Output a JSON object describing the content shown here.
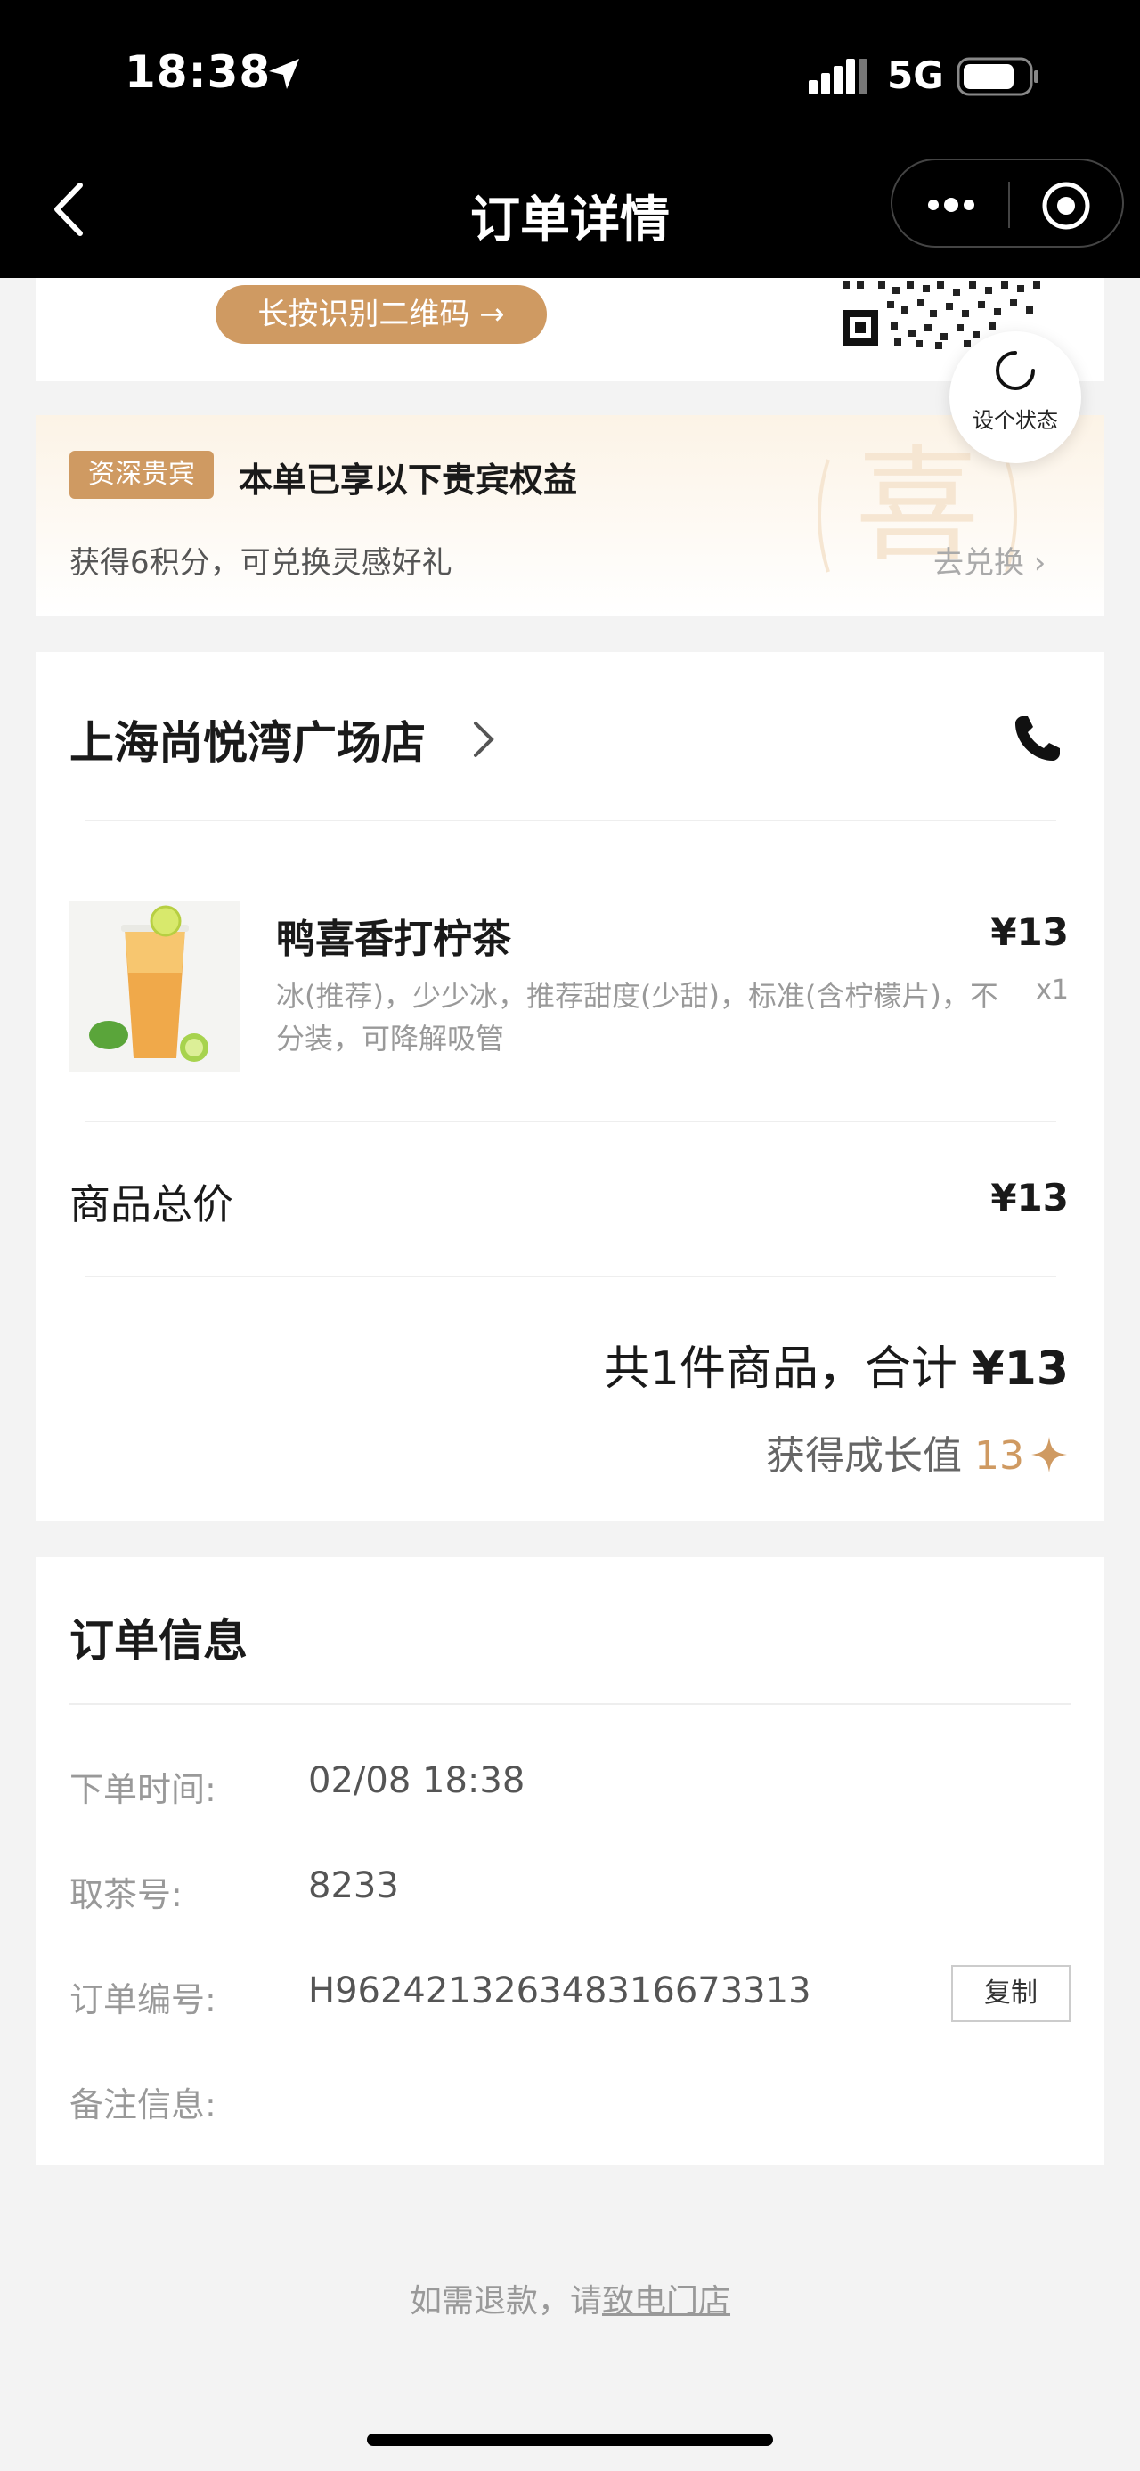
{
  "status_bar": {
    "time": "18:38",
    "network": "5G"
  },
  "nav": {
    "title": "订单详情"
  },
  "qr": {
    "button_label": "长按识别二维码 →"
  },
  "set_status": {
    "label": "设个状态"
  },
  "vip": {
    "tag": "资深贵宾",
    "title": "本单已享以下贵宾权益",
    "subtitle": "获得6积分，可兑换灵感好礼",
    "link": "去兑换 ›",
    "seal_char": "喜"
  },
  "shop": {
    "name": "上海尚悦湾广场店",
    "item": {
      "name": "鸭喜香打柠茶",
      "desc": "冰(推荐)，少少冰，推荐甜度(少甜)，标准(含柠檬片)，不分装，可降解吸管",
      "price": "¥13",
      "qty": "x1"
    },
    "subtotal_label": "商品总价",
    "subtotal_value": "¥13",
    "summary_prefix": "共1件商品，合计 ",
    "summary_amount": "¥13",
    "growth_label": "获得成长值 ",
    "growth_value": "13"
  },
  "order_info": {
    "title": "订单信息",
    "rows": [
      {
        "label": "下单时间:",
        "value": "02/08 18:38"
      },
      {
        "label": "取茶号:",
        "value": "8233"
      },
      {
        "label": "订单编号:",
        "value": "H962421326348316673313"
      },
      {
        "label": "备注信息:",
        "value": ""
      }
    ],
    "copy_label": "复制"
  },
  "footer": {
    "refund_prefix": "如需退款，请",
    "refund_link": "致电门店"
  },
  "colors": {
    "accent": "#cf9a62",
    "topbar": "#000000",
    "background": "#f3f3f3"
  }
}
